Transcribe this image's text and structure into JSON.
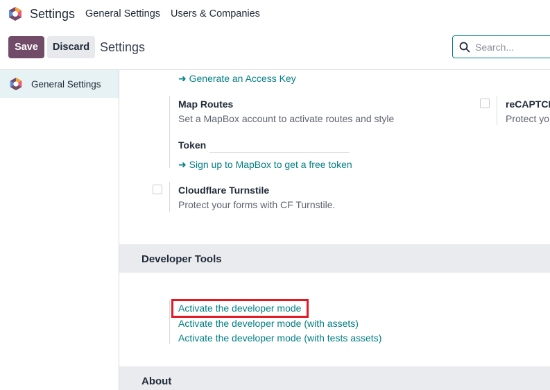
{
  "navbar": {
    "app_title": "Settings",
    "links": [
      "General Settings",
      "Users & Companies"
    ]
  },
  "control_panel": {
    "save_label": "Save",
    "discard_label": "Discard",
    "title": "Settings",
    "search_placeholder": "Search..."
  },
  "sidebar": {
    "items": [
      {
        "label": "General Settings",
        "active": true
      }
    ]
  },
  "main": {
    "access_key_link": "Generate an Access Key",
    "map_routes": {
      "title": "Map Routes",
      "description": "Set a MapBox account to activate routes and style",
      "token_label": "Token",
      "token_value": "",
      "signup_link": "Sign up to MapBox to get a free token"
    },
    "recaptcha": {
      "title": "reCAPTCH",
      "description": "Protect yo"
    },
    "cloudflare": {
      "title": "Cloudflare Turnstile",
      "description": "Protect your forms with CF Turnstile."
    },
    "developer_tools": {
      "header": "Developer Tools",
      "links": [
        "Activate the developer mode",
        "Activate the developer mode (with assets)",
        "Activate the developer mode (with tests assets)"
      ]
    },
    "about": {
      "header": "About"
    }
  },
  "colors": {
    "brand": "#714b67",
    "link": "#017e84",
    "highlight": "#e01b24",
    "sidebar_active": "#e6f2f3",
    "section_header": "#e9ebee"
  }
}
